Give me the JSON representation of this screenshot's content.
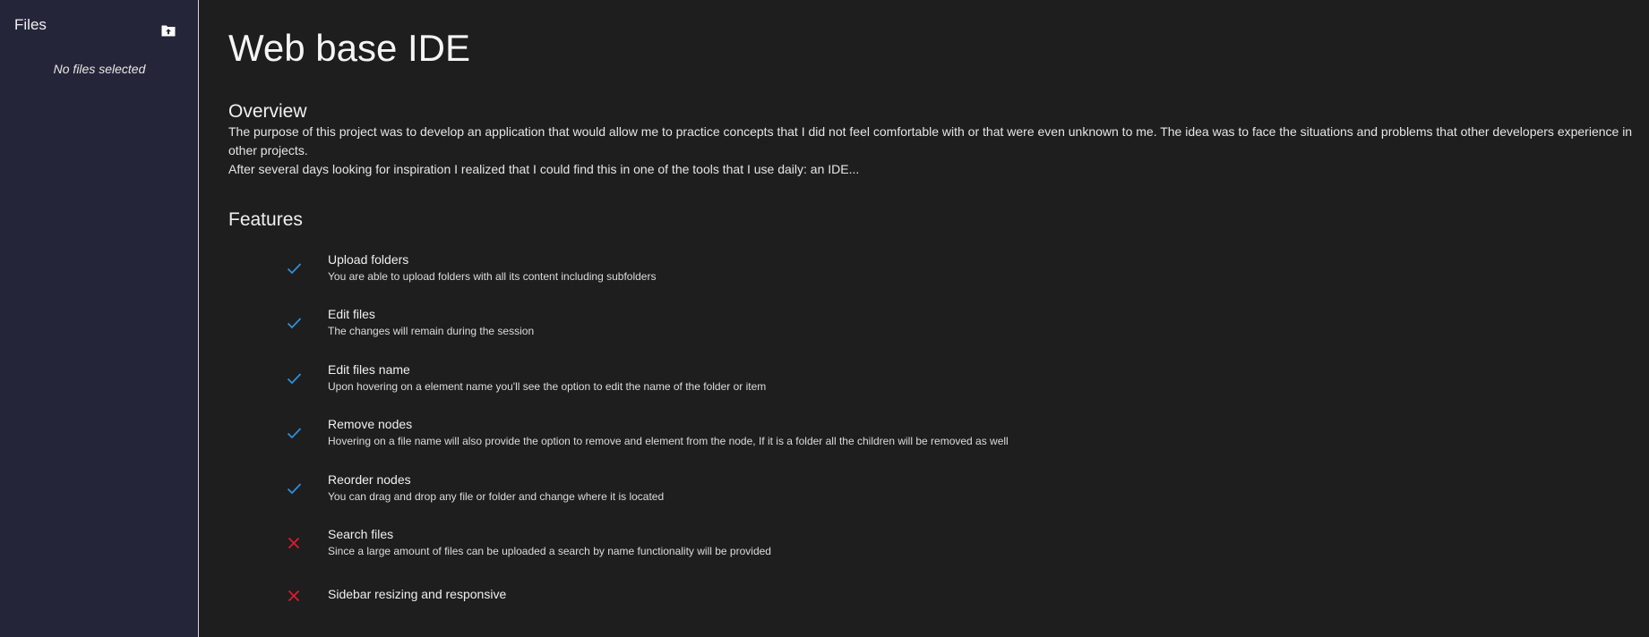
{
  "sidebar": {
    "title": "Files",
    "upload_icon": "folder-upload-icon",
    "empty_text": "No files selected"
  },
  "main": {
    "title": "Web base IDE",
    "overview": {
      "heading": "Overview",
      "paragraphs": [
        "The purpose of this project was to develop an application that would allow me to practice concepts that I did not feel comfortable with or that were even unknown to me. The idea was to face the situations and problems that other developers experience in other projects.",
        "After several days looking for inspiration I realized that I could find this in one of the tools that I use daily: an IDE..."
      ]
    },
    "features": {
      "heading": "Features",
      "items": [
        {
          "title": "Upload folders",
          "description": "You are able to upload folders with all its content including subfolders",
          "done": true
        },
        {
          "title": "Edit files",
          "description": "The changes will remain during the session",
          "done": true
        },
        {
          "title": "Edit files name",
          "description": "Upon hovering on a element name you'll see the option to edit the name of the folder or item",
          "done": true
        },
        {
          "title": "Remove nodes",
          "description": "Hovering on a file name will also provide the option to remove and element from the node, If it is a folder all the children will be removed as well",
          "done": true
        },
        {
          "title": "Reorder nodes",
          "description": "You can drag and drop any file or folder and change where it is located",
          "done": true
        },
        {
          "title": "Search files",
          "description": "Since a large amount of files can be uploaded a search by name functionality will be provided",
          "done": false
        },
        {
          "title": "Sidebar resizing and responsive",
          "description": "",
          "done": false
        }
      ]
    }
  },
  "colors": {
    "check": "#2f8fd8",
    "cross": "#e0192f",
    "sidebar_bg": "#25253a",
    "main_bg": "#1e1e1e"
  }
}
